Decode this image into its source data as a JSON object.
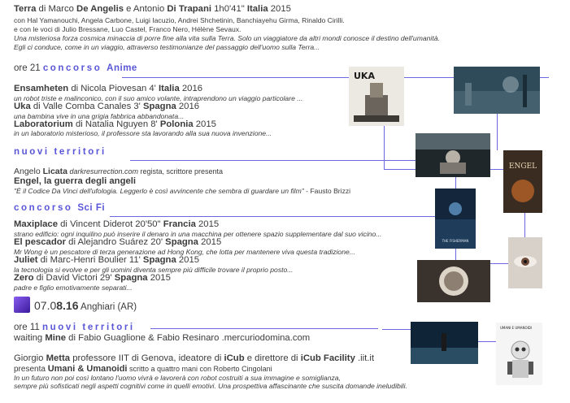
{
  "terra": {
    "title": "Terra",
    "by": " di Marco ",
    "dir1": "De Angelis",
    "and": " e Antonio ",
    "dir2": "Di Trapani",
    "duration": " 1h0'41\" ",
    "country": "Italia",
    "year": " 2015",
    "cast": "con Hal Yamanouchi, Angela Carbone, Luigi Iacuzio, Andrei Shchetinin, Banchiayehu Girma, Rinaldo Cirilli.",
    "voices": "e con le voci di Julio Bressane, Luo Castel, Franco Nero, Hélène Sevaux.",
    "desc1": "Una misteriosa forza cosmica minaccia di porre fine alla vita sulla Terra. Solo un viaggiatore da altri mondi conosce il destino dell'umanità.",
    "desc2": "Egli ci conduce, come in un viaggio, attraverso testimonianze del passaggio dell'uomo sulla Terra..."
  },
  "anime": {
    "time": "ore 21 ",
    "label": "concorso",
    "tag": "Anime",
    "films": [
      {
        "title": "Ensamheten",
        "by": " di Nicola Piovesan 4' ",
        "country": "Italia",
        "year": " 2016",
        "desc": "un robot triste e malinconico, con il suo amico volante, intraprendono un viaggio particolare ..."
      },
      {
        "title": "Uka",
        "by": " di Valle Comba Canales 3' ",
        "country": "Spagna",
        "year": " 2016",
        "desc": "una bambina vive in una grigia fabbrica abbandonata..."
      },
      {
        "title": "Laboratorium",
        "by": " di Natalia Nguyen 8' ",
        "country": "Polonia",
        "year": " 2015",
        "desc": "in un laboratorio misterioso, il professore sta lavorando alla sua nuova invenzione..."
      }
    ]
  },
  "nuovi1": {
    "label": "nuovi territori",
    "guest_name": "Angelo ",
    "guest_surname": "Licata",
    "guest_site": " darkresurrection.com",
    "guest_role": " regista, scrittore presenta",
    "work": "Engel, la guerra degli angeli",
    "quote": "\"È il Codice Da Vinci dell'ufologia. Leggerlo è così avvincente che sembra di guardare un film\"",
    "quote_author": " - Fausto Brizzi"
  },
  "scifi": {
    "label": "concorso",
    "tag": "Sci Fi",
    "films": [
      {
        "title": "Maxiplace",
        "by": " di Vincent Diderot 20'50\" ",
        "country": "Francia",
        "year": " 2015",
        "desc": "strano edificio: ogni inquilino può inserire il denaro in una macchina per ottenere spazio supplementare dal suo vicino..."
      },
      {
        "title": "El pescador",
        "by": " di Alejandro Suárez 20' ",
        "country": "Spagna",
        "year": " 2015",
        "desc": "Mr Wong è un pescatore di terza generazione ad Hong Kong, che lotta per mantenere viva questa tradizione..."
      },
      {
        "title": "Juliet",
        "by": " di Marc-Henri Boulier 11' ",
        "country": "Spagna",
        "year": " 2015",
        "desc": "la tecnologia si evolve e per gli uomini diventa sempre più difficile trovare il proprio posto..."
      },
      {
        "title": "Zero",
        "by": " di David Victori 29' ",
        "country": "Spagna",
        "year": " 2015",
        "desc": "padre e figlio emotivamente separati..."
      }
    ]
  },
  "date": {
    "d1": "07.0",
    "d2": "8.16",
    "place": " Anghiari (AR)"
  },
  "nuovi2": {
    "time": "ore 11 ",
    "label": "nuovi territori",
    "waiting_pre": "waiting ",
    "waiting_title": "Mine",
    "waiting_by": " di Fabio Guaglione & Fabio Resinaro .mercuriodomina.com",
    "guest_name": "Giorgio ",
    "guest_surname": "Metta",
    "guest_role": " professore IIT di Genova, ideatore di ",
    "icub": "iCub",
    "dir": " e direttore di ",
    "facility": "iCub Facility",
    "site": " .iit.it",
    "presents": "presenta ",
    "book": "Umani & Umanoidi",
    "book_by": " scritto a quattro mani con Roberto Cingolani",
    "desc1": "In un futuro non poi così lontano l'uomo vivrà e lavorerà con robot costruiti a sua immagine e somiglianza,",
    "desc2": "sempre più sofisticati negli aspetti cognitivi come in quelli emotivi. Una prospettiva affascinante che suscita domande ineludibili."
  },
  "posters": {
    "uka": "UKA",
    "engel": "ENGEL",
    "fisherman": "THE FISHERMAN",
    "book": "UMANI E UMANOIDI"
  },
  "colors": {
    "accent": "#5a56d8",
    "text": "#3b3b3b"
  }
}
